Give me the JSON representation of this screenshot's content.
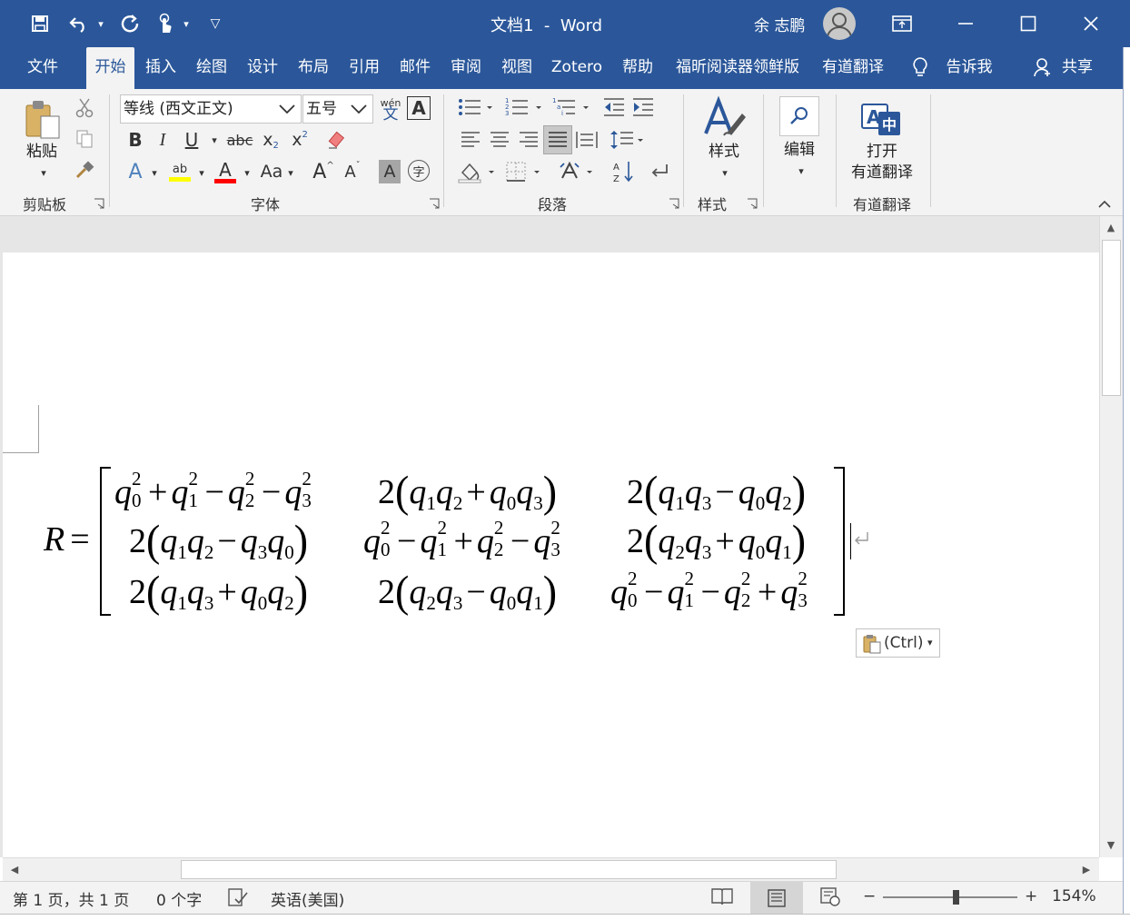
{
  "titlebar": {
    "doc_title": "文档1  -  Word",
    "user_name": "余 志鹏"
  },
  "tabs": [
    "文件",
    "开始",
    "插入",
    "绘图",
    "设计",
    "布局",
    "引用",
    "邮件",
    "审阅",
    "视图",
    "Zotero",
    "帮助",
    "福昕阅读器领鲜版",
    "有道翻译",
    "告诉我",
    "共享"
  ],
  "ribbon": {
    "clipboard": {
      "paste_label": "粘贴",
      "group_label": "剪贴板"
    },
    "font": {
      "font_name": "等线 (西文正文)",
      "font_size": "五号",
      "phonetic_top": "wén",
      "phonetic_bottom": "文",
      "border_char": "A",
      "bold": "B",
      "italic": "I",
      "underline": "U",
      "strike": "abc",
      "sub_base": "x",
      "sub_mark": "2",
      "sup_base": "x",
      "sup_mark": "2",
      "text_effect": "A",
      "highlight": "ab",
      "font_color": "A",
      "change_case": "Aa",
      "grow": "A",
      "shrink": "A",
      "char_shading": "A",
      "enclose": "字",
      "group_label": "字体"
    },
    "paragraph": {
      "group_label": "段落"
    },
    "styles": {
      "styles_label": "样式",
      "group_label": "样式"
    },
    "editing": {
      "label": "编辑"
    },
    "youdao": {
      "open_label_1": "打开",
      "open_label_2": "有道翻译",
      "group_label": "有道翻译"
    }
  },
  "equation": {
    "lhs": "R",
    "eq": "="
  },
  "paste_options": {
    "label": "(Ctrl)"
  },
  "status": {
    "page": "第 1 页，共 1 页",
    "words": "0 个字",
    "language": "英语(美国)",
    "zoom_minus": "−",
    "zoom_plus": "+",
    "zoom": "154%",
    "zoom_level_fraction": 0.54
  },
  "colors": {
    "brand": "#2b579a",
    "highlight": "#ffff00",
    "font_red": "#ff0000"
  }
}
